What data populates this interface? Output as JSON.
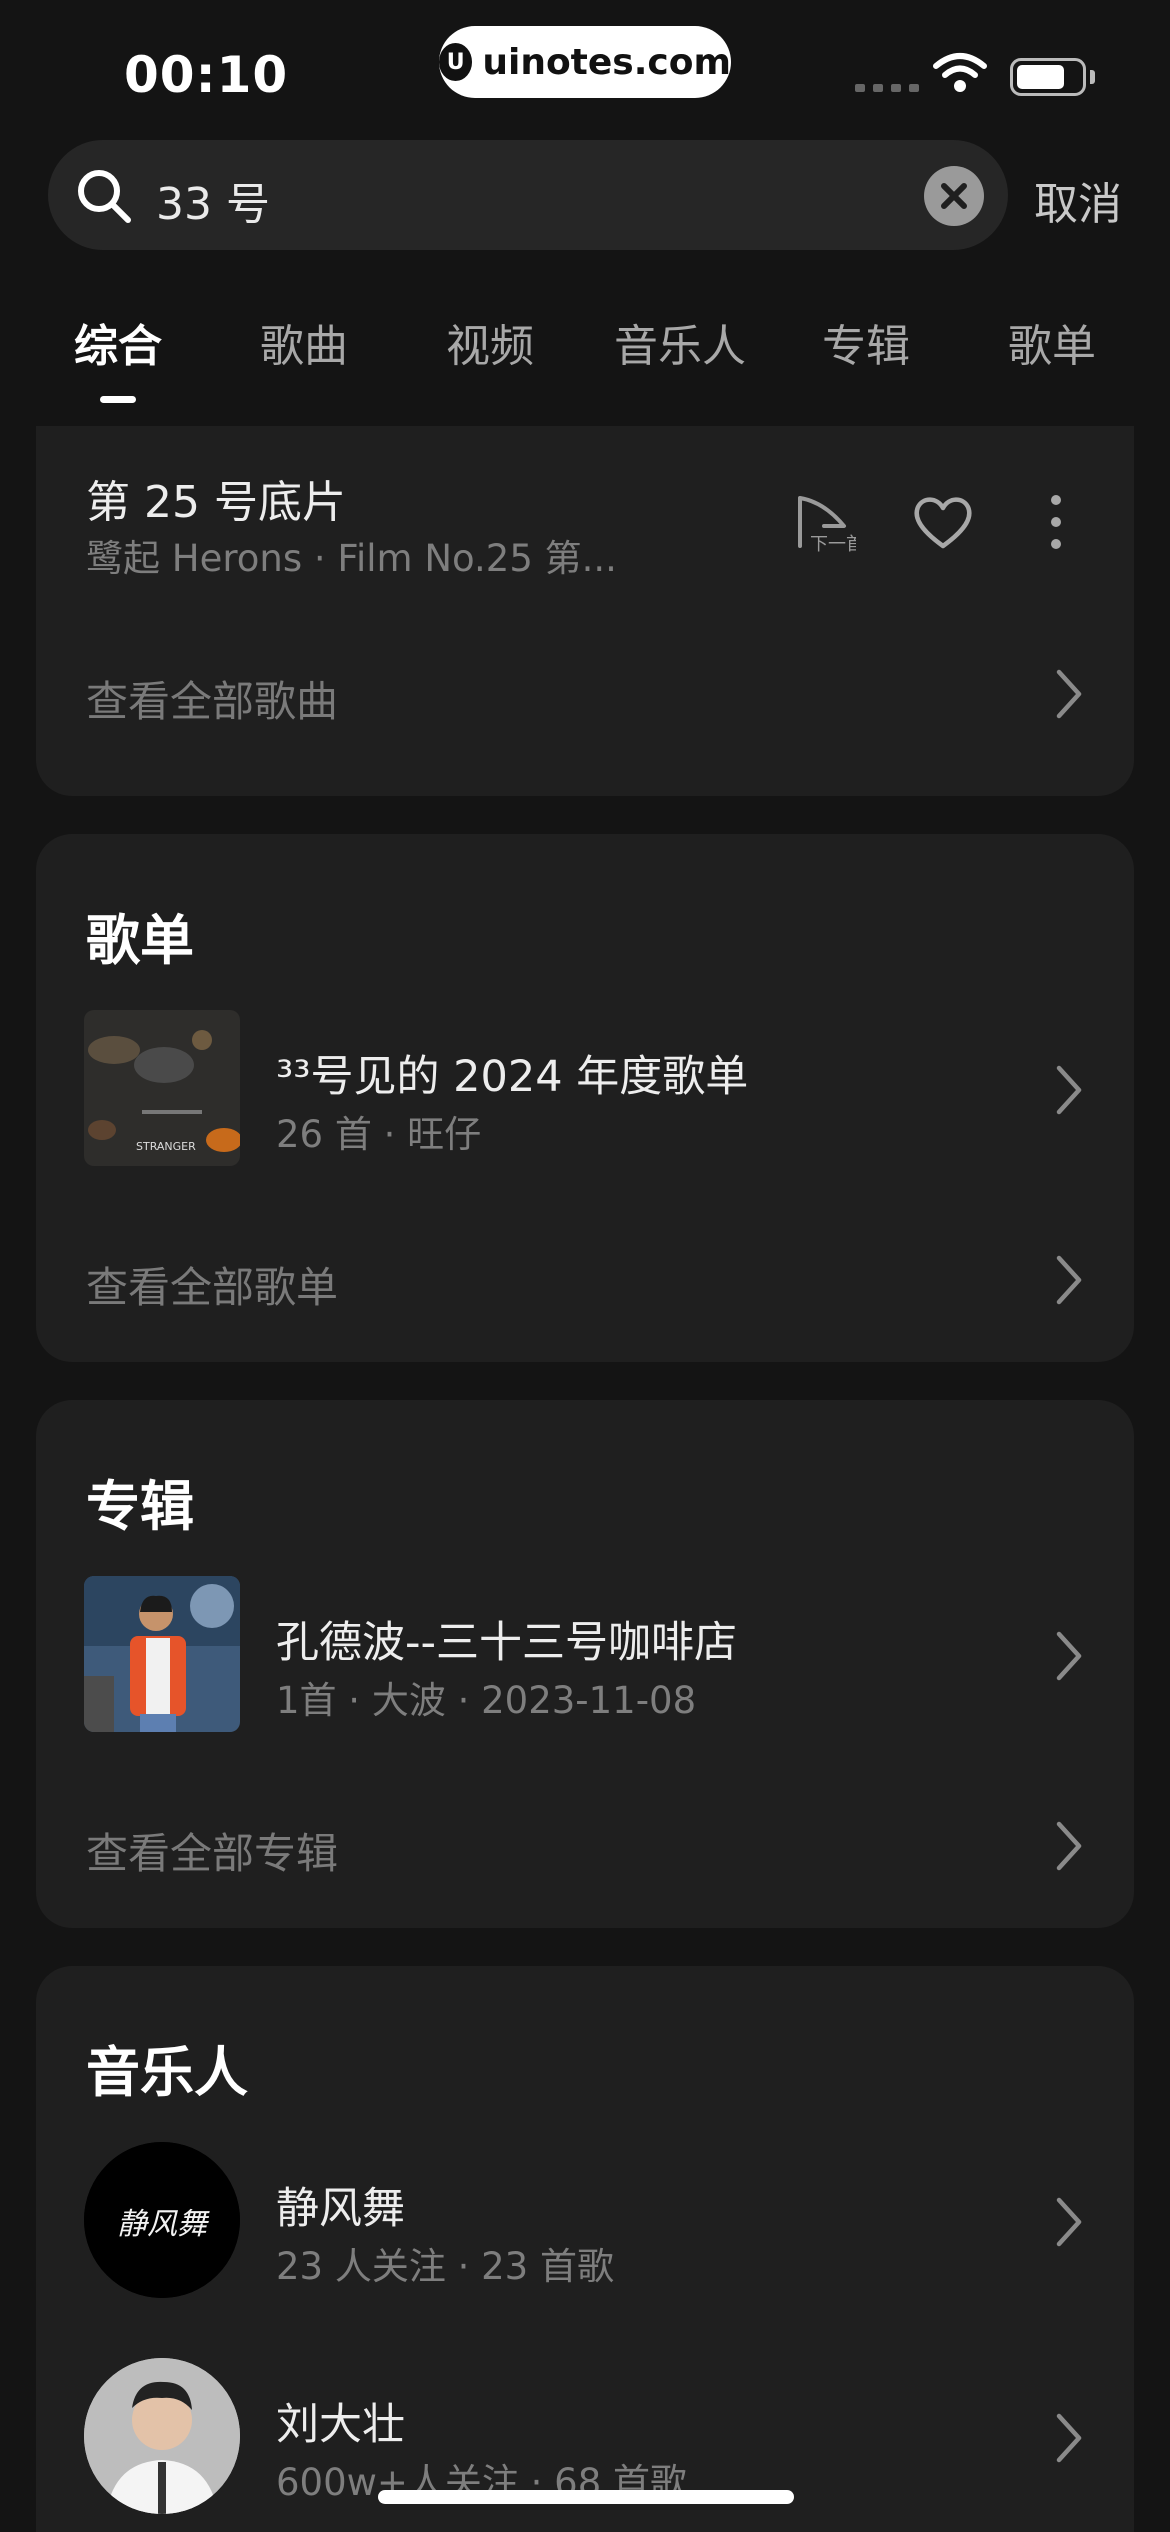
{
  "status_bar": {
    "time": "00:10",
    "watermark": "uinotes.com",
    "watermark_logo": "U"
  },
  "search": {
    "query": "33 号",
    "cancel_label": "取消"
  },
  "tabs": [
    {
      "label": "综合",
      "active": true
    },
    {
      "label": "歌曲",
      "active": false
    },
    {
      "label": "视频",
      "active": false
    },
    {
      "label": "音乐人",
      "active": false
    },
    {
      "label": "专辑",
      "active": false
    },
    {
      "label": "歌单",
      "active": false
    }
  ],
  "songs_section": {
    "song": {
      "title": "第 25 号底片",
      "subtitle": "鹭起 Herons · Film No.25 第...",
      "next_label": "下一首"
    },
    "view_all": "查看全部歌曲"
  },
  "playlist_section": {
    "title": "歌单",
    "item": {
      "title": "³³号见的 2024 年度歌单",
      "subtitle": "26 首 · 旺仔",
      "cover_text": "STRANGER"
    },
    "view_all": "查看全部歌单"
  },
  "album_section": {
    "title": "专辑",
    "item": {
      "title": "孔德波--三十三号咖啡店",
      "subtitle": "1首 · 大波 · 2023-11-08"
    },
    "view_all": "查看全部专辑"
  },
  "artist_section": {
    "title": "音乐人",
    "items": [
      {
        "name": "静风舞",
        "subtitle": "23 人关注 · 23 首歌",
        "avatar_text": "静风舞"
      },
      {
        "name": "刘大壮",
        "subtitle": "600w+人关注 · 68 首歌"
      }
    ]
  },
  "colors": {
    "background": "#141414",
    "card": "#1f1f1f",
    "accent": "#ffffff",
    "muted": "#7e7e7e"
  },
  "icons": [
    "search-icon",
    "clear-icon",
    "next-song-icon",
    "heart-icon",
    "more-icon",
    "chevron-right-icon",
    "wifi-icon",
    "battery-icon"
  ]
}
